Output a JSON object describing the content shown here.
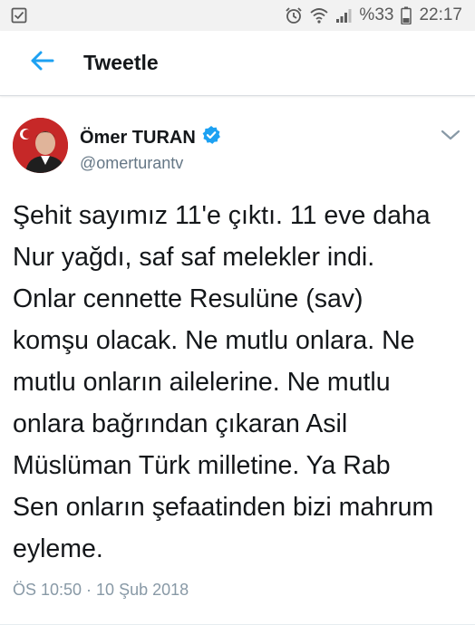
{
  "status_bar": {
    "battery_percent": "%33",
    "time": "22:17",
    "icons": [
      "checkbox-notification-icon",
      "alarm-icon",
      "wifi-icon",
      "signal-icon",
      "battery-icon"
    ]
  },
  "header": {
    "title": "Tweetle",
    "back_icon": "arrow-left-icon"
  },
  "tweet": {
    "author_name": "Ömer TURAN",
    "author_handle": "@omerturantv",
    "verified": true,
    "text_lines": [
      "Şehit sayımız 11'e çıktı. 11 eve daha",
      "Nur yağdı, saf saf melekler indi.",
      "Onlar cennette Resulüne (sav)",
      "komşu olacak. Ne mutlu onlara. Ne",
      "mutlu onların ailelerine. Ne mutlu",
      "onlara bağrından çıkaran Asil",
      "Müslüman Türk milletine. Ya Rab",
      "Sen onların şefaatinden bizi mahrum",
      "eyleme."
    ],
    "timestamp": "ÖS 10:50 · 10 Şub 2018"
  },
  "colors": {
    "accent": "#1da1f2",
    "text": "#14171a",
    "secondary": "#657786",
    "status_bar_bg": "#f2f2f2"
  }
}
